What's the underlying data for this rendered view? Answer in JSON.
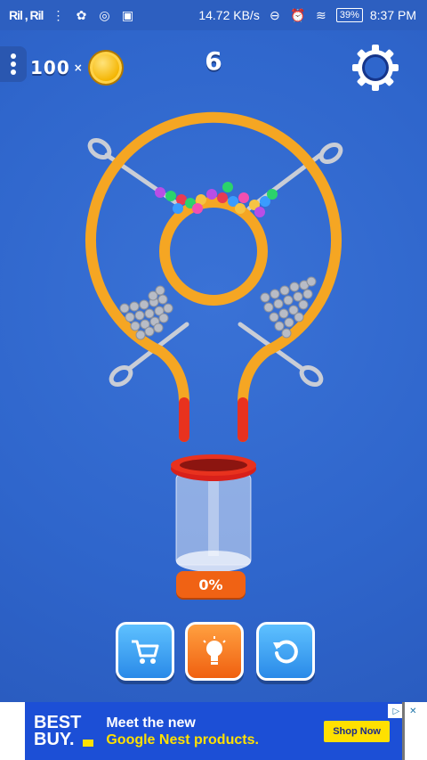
{
  "statusbar": {
    "signal1": "Ril , Ril",
    "speed": "14.72 KB/s",
    "battery": "39%",
    "time": "8:37 PM"
  },
  "hud": {
    "coins": "100",
    "coins_multiplier": "×",
    "level": "6"
  },
  "bowl": {
    "progress": "0%",
    "fill_fraction": 0
  },
  "buttons": {
    "shop_icon": "shopping-cart-icon",
    "hint_icon": "lightbulb-icon",
    "restart_icon": "restart-icon"
  },
  "ad": {
    "brand_line1": "BEST",
    "brand_line2": "BUY.",
    "headline1": "Meet the new",
    "headline2": "Google Nest products.",
    "cta": "Shop Now"
  },
  "colors": {
    "background": "#2f66cc",
    "tube": "#f5a623",
    "tube_red": "#e8321e",
    "pin": "#c9cdd6",
    "progress": "#f06214",
    "accent_yellow": "#ffe000"
  }
}
